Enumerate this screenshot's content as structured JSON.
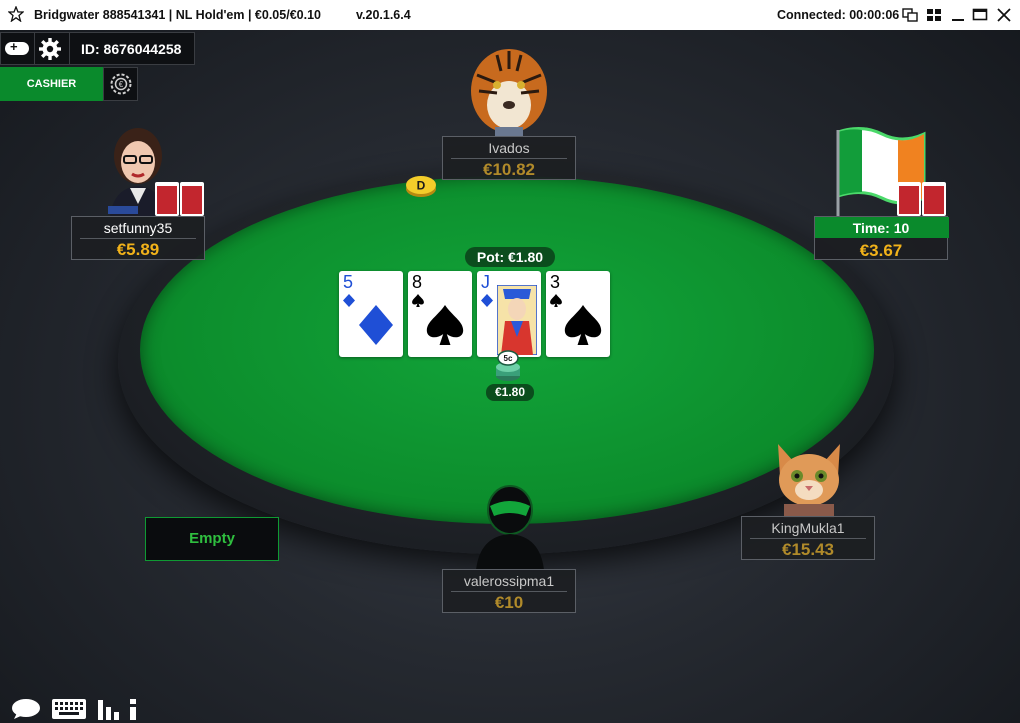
{
  "titlebar": {
    "title": "Bridgwater 888541341 | NL Hold'em | €0.05/€0.10",
    "version": "v.20.1.6.4",
    "status": "Connected: 00:00:06"
  },
  "toolbar": {
    "toggle_symbol": "+",
    "player_id": "ID: 8676044258",
    "cashier_label": "CASHIER"
  },
  "players": [
    {
      "seat": "top",
      "name": "Ivados",
      "stack": "€10.82",
      "avatar": "tiger-avatar"
    },
    {
      "seat": "left",
      "name": "setfunny35",
      "stack": "€5.89",
      "avatar": "woman-avatar"
    },
    {
      "seat": "right",
      "name": "Time: 10",
      "stack": "€3.67",
      "avatar": "ireland-flag-avatar"
    },
    {
      "seat": "bottom-right",
      "name": "KingMukla1",
      "stack": "€15.43",
      "avatar": "kitten-avatar"
    },
    {
      "seat": "bottom",
      "name": "valerossipma1",
      "stack": "€10",
      "avatar": "masked-avatar"
    }
  ],
  "empty_seat_label": "Empty",
  "board": {
    "pot": "Pot: €1.80",
    "cards": [
      {
        "rank": "5",
        "suit": "diamonds",
        "color": "#1f4fd6"
      },
      {
        "rank": "8",
        "suit": "spades",
        "color": "#000000"
      },
      {
        "rank": "J",
        "suit": "diamonds",
        "color": "#1f4fd6"
      },
      {
        "rank": "3",
        "suit": "spades",
        "color": "#000000"
      }
    ],
    "bet_chip_label": "5c",
    "bet_amount": "€1.80",
    "dealer_label": "D"
  },
  "colors": {
    "felt": "#0c8d2c",
    "stack_gold": "#f1b21a",
    "accent_green": "#0a8a2c"
  },
  "bottom_icons": [
    "chat-icon",
    "keyboard-icon",
    "stats-icon",
    "info-icon"
  ]
}
